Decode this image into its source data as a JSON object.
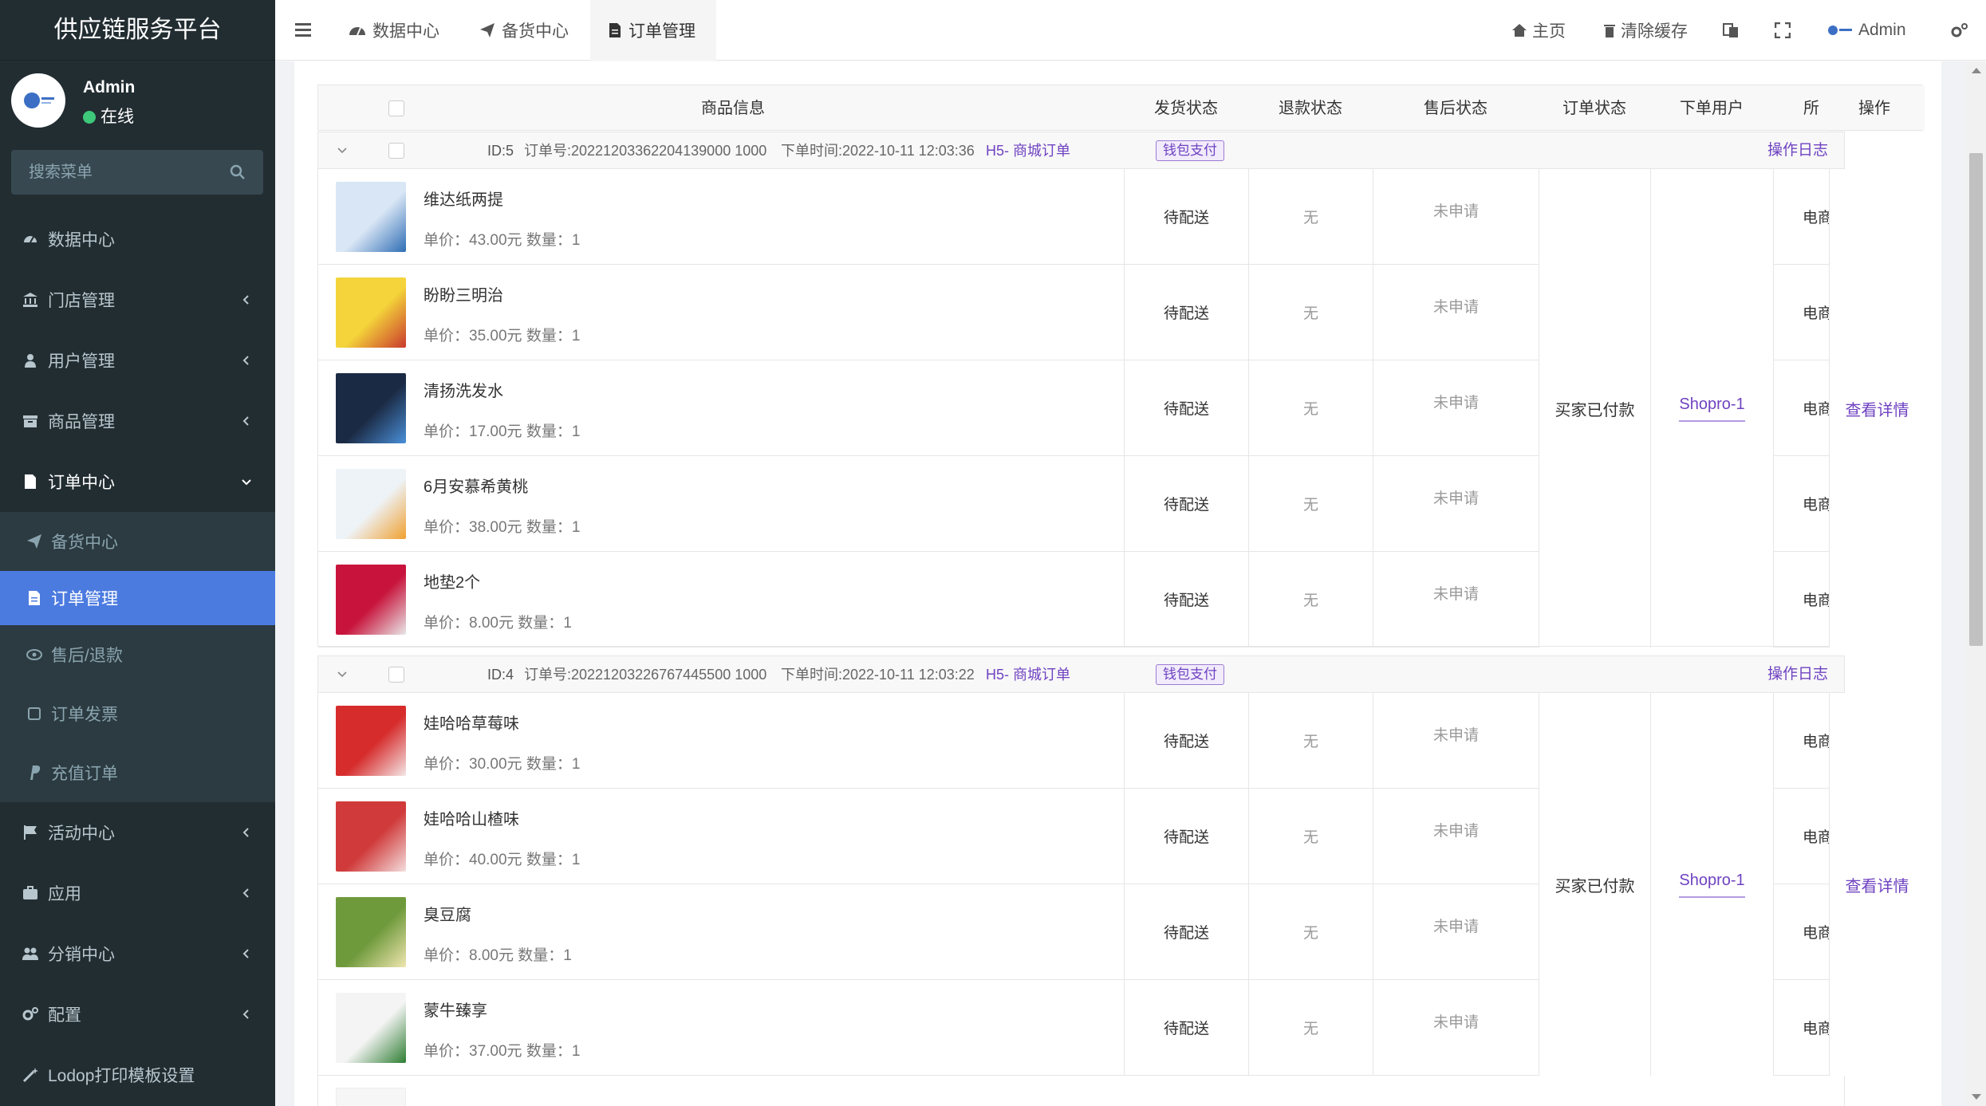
{
  "brand": "供应链服务平台",
  "user": {
    "name": "Admin",
    "status": "在线"
  },
  "search": {
    "placeholder": "搜索菜单"
  },
  "sidebar": {
    "items": [
      {
        "label": "数据中心",
        "icon": "dashboard-icon"
      },
      {
        "label": "门店管理",
        "icon": "bank-icon"
      },
      {
        "label": "用户管理",
        "icon": "user-icon"
      },
      {
        "label": "商品管理",
        "icon": "box-icon"
      },
      {
        "label": "订单中心",
        "icon": "file-icon"
      }
    ],
    "sub_items": [
      {
        "label": "备货中心",
        "icon": "send-icon"
      },
      {
        "label": "订单管理",
        "icon": "file-icon"
      },
      {
        "label": "售后/退款",
        "icon": "refund-icon"
      },
      {
        "label": "订单发票",
        "icon": "invoice-icon"
      },
      {
        "label": "充值订单",
        "icon": "paypal-icon"
      }
    ],
    "bottom_items": [
      {
        "label": "活动中心",
        "icon": "flag-icon"
      },
      {
        "label": "应用",
        "icon": "briefcase-icon"
      },
      {
        "label": "分销中心",
        "icon": "users-icon"
      },
      {
        "label": "配置",
        "icon": "gears-icon"
      },
      {
        "label": "Lodop打印模板设置",
        "icon": "magic-icon"
      }
    ]
  },
  "topbar": {
    "tabs": [
      "数据中心",
      "备货中心",
      "订单管理"
    ],
    "home": "主页",
    "clear_cache": "清除缓存",
    "admin": "Admin"
  },
  "table": {
    "headers": {
      "product": "商品信息",
      "ship": "发货状态",
      "refund": "退款状态",
      "aftersale": "售后状态",
      "order_status": "订单状态",
      "buyer": "下单用户",
      "belong": "所属",
      "action": "操作"
    }
  },
  "orders": [
    {
      "id": "ID:5",
      "order_no": "订单号:2022120336220413900010 00",
      "order_no_text": "订单号:20221203362204139000 1000",
      "order_no_full": "订单号:20221203362204139000 1000",
      "time": "下单时间:2022-10-11 12:03:36",
      "source": "H5- 商城订单",
      "pay": "钱包支付",
      "log": "操作日志",
      "status": "买家已付款",
      "buyer": "Shopro-1",
      "detail": "查看详情",
      "items": [
        {
          "name": "维达纸两提",
          "meta": "单价：43.00元   数量：1",
          "ship": "待配送",
          "refund": "无",
          "aftersale": "未申请",
          "belong": "电商"
        },
        {
          "name": "盼盼三明治",
          "meta": "单价：35.00元   数量：1",
          "ship": "待配送",
          "refund": "无",
          "aftersale": "未申请",
          "belong": "电商"
        },
        {
          "name": "清扬洗发水",
          "meta": "单价：17.00元   数量：1",
          "ship": "待配送",
          "refund": "无",
          "aftersale": "未申请",
          "belong": "电商"
        },
        {
          "name": "6月安慕希黄桃",
          "meta": "单价：38.00元   数量：1",
          "ship": "待配送",
          "refund": "无",
          "aftersale": "未申请",
          "belong": "电商"
        },
        {
          "name": "地垫2个",
          "meta": "单价：8.00元   数量：1",
          "ship": "待配送",
          "refund": "无",
          "aftersale": "未申请",
          "belong": "电商"
        }
      ]
    },
    {
      "id": "ID:4",
      "time": "下单时间:2022-10-11 12:03:22",
      "source": "H5- 商城订单",
      "pay": "钱包支付",
      "log": "操作日志",
      "status": "买家已付款",
      "buyer": "Shopro-1",
      "detail": "查看详情",
      "items": [
        {
          "name": "娃哈哈草莓味",
          "meta": "单价：30.00元   数量：1",
          "ship": "待配送",
          "refund": "无",
          "aftersale": "未申请",
          "belong": "电商"
        },
        {
          "name": "娃哈哈山楂味",
          "meta": "单价：40.00元   数量：1",
          "ship": "待配送",
          "refund": "无",
          "aftersale": "未申请",
          "belong": "电商"
        },
        {
          "name": "臭豆腐",
          "meta": "单价：8.00元   数量：1",
          "ship": "待配送",
          "refund": "无",
          "aftersale": "未申请",
          "belong": "电商"
        },
        {
          "name": "蒙牛臻享",
          "meta": "单价：37.00元   数量：1",
          "ship": "待配送",
          "refund": "无",
          "aftersale": "未申请",
          "belong": "电商"
        }
      ]
    }
  ],
  "order_numbers": [
    "订单号:20221203362204139000 1000",
    "订单号:20221203226767445500 1000"
  ],
  "colors": {
    "sidebar": "#222d32",
    "active": "#4c7be0",
    "link": "#6f42c1"
  }
}
